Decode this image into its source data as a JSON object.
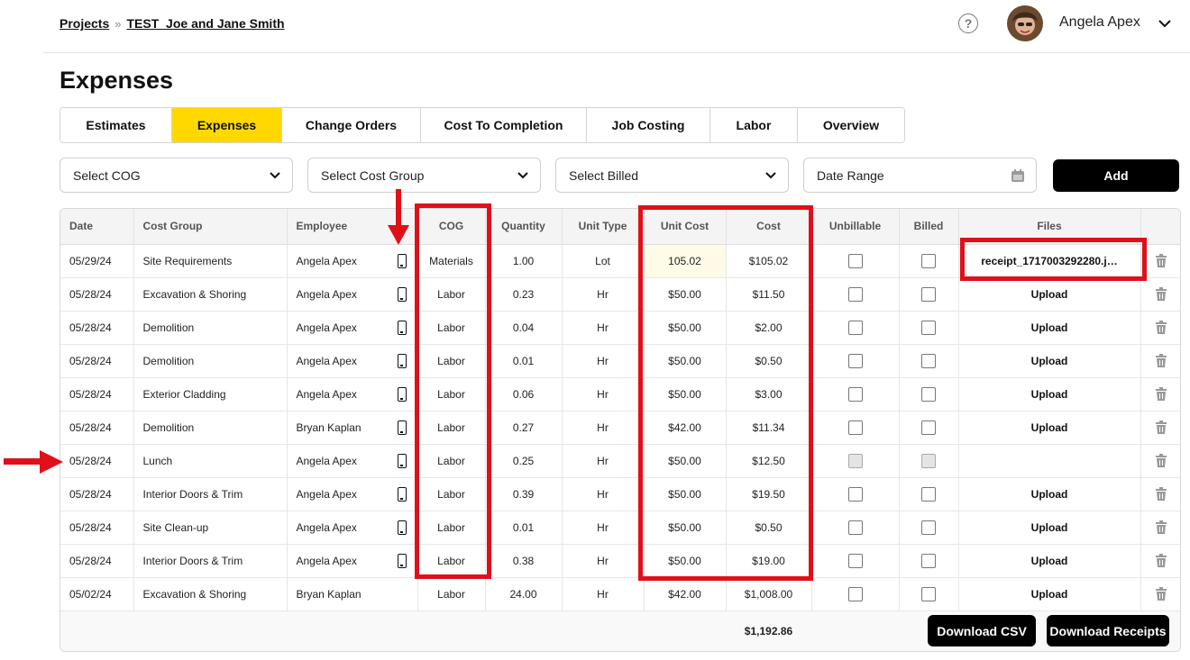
{
  "breadcrumb": {
    "projects": "Projects",
    "separator": "»",
    "project": "TEST_Joe and Jane Smith"
  },
  "header": {
    "help": "?",
    "user_name": "Angela Apex"
  },
  "page": {
    "title": "Expenses"
  },
  "tabs": [
    {
      "label": "Estimates",
      "active": false
    },
    {
      "label": "Expenses",
      "active": true
    },
    {
      "label": "Change Orders",
      "active": false
    },
    {
      "label": "Cost To Completion",
      "active": false
    },
    {
      "label": "Job Costing",
      "active": false
    },
    {
      "label": "Labor",
      "active": false
    },
    {
      "label": "Overview",
      "active": false
    }
  ],
  "filters": {
    "cog": "Select COG",
    "cost_group": "Select Cost Group",
    "billed": "Select Billed",
    "date_range": "Date Range",
    "add": "Add"
  },
  "table": {
    "columns": [
      "Date",
      "Cost Group",
      "Employee",
      "COG",
      "Quantity",
      "Unit Type",
      "Unit Cost",
      "Cost",
      "Unbillable",
      "Billed",
      "Files"
    ],
    "rows": [
      {
        "date": "05/29/24",
        "cost_group": "Site Requirements",
        "employee": "Angela Apex",
        "mobile": true,
        "cog": "Materials",
        "quantity": "1.00",
        "unit_type": "Lot",
        "unit_cost": "105.02",
        "cost": "$105.02",
        "file": "receipt_1717003292280.j…",
        "disabled": false
      },
      {
        "date": "05/28/24",
        "cost_group": "Excavation & Shoring",
        "employee": "Angela Apex",
        "mobile": true,
        "cog": "Labor",
        "quantity": "0.23",
        "unit_type": "Hr",
        "unit_cost": "$50.00",
        "cost": "$11.50",
        "file": "Upload",
        "disabled": false
      },
      {
        "date": "05/28/24",
        "cost_group": "Demolition",
        "employee": "Angela Apex",
        "mobile": true,
        "cog": "Labor",
        "quantity": "0.04",
        "unit_type": "Hr",
        "unit_cost": "$50.00",
        "cost": "$2.00",
        "file": "Upload",
        "disabled": false
      },
      {
        "date": "05/28/24",
        "cost_group": "Demolition",
        "employee": "Angela Apex",
        "mobile": true,
        "cog": "Labor",
        "quantity": "0.01",
        "unit_type": "Hr",
        "unit_cost": "$50.00",
        "cost": "$0.50",
        "file": "Upload",
        "disabled": false
      },
      {
        "date": "05/28/24",
        "cost_group": "Exterior Cladding",
        "employee": "Angela Apex",
        "mobile": true,
        "cog": "Labor",
        "quantity": "0.06",
        "unit_type": "Hr",
        "unit_cost": "$50.00",
        "cost": "$3.00",
        "file": "Upload",
        "disabled": false
      },
      {
        "date": "05/28/24",
        "cost_group": "Demolition",
        "employee": "Bryan Kaplan",
        "mobile": true,
        "cog": "Labor",
        "quantity": "0.27",
        "unit_type": "Hr",
        "unit_cost": "$42.00",
        "cost": "$11.34",
        "file": "Upload",
        "disabled": false
      },
      {
        "date": "05/28/24",
        "cost_group": "Lunch",
        "employee": "Angela Apex",
        "mobile": true,
        "cog": "Labor",
        "quantity": "0.25",
        "unit_type": "Hr",
        "unit_cost": "$50.00",
        "cost": "$12.50",
        "file": "",
        "disabled": true
      },
      {
        "date": "05/28/24",
        "cost_group": "Interior Doors & Trim",
        "employee": "Angela Apex",
        "mobile": true,
        "cog": "Labor",
        "quantity": "0.39",
        "unit_type": "Hr",
        "unit_cost": "$50.00",
        "cost": "$19.50",
        "file": "Upload",
        "disabled": false
      },
      {
        "date": "05/28/24",
        "cost_group": "Site Clean-up",
        "employee": "Angela Apex",
        "mobile": true,
        "cog": "Labor",
        "quantity": "0.01",
        "unit_type": "Hr",
        "unit_cost": "$50.00",
        "cost": "$0.50",
        "file": "Upload",
        "disabled": false
      },
      {
        "date": "05/28/24",
        "cost_group": "Interior Doors & Trim",
        "employee": "Angela Apex",
        "mobile": true,
        "cog": "Labor",
        "quantity": "0.38",
        "unit_type": "Hr",
        "unit_cost": "$50.00",
        "cost": "$19.00",
        "file": "Upload",
        "disabled": false
      },
      {
        "date": "05/02/24",
        "cost_group": "Excavation & Shoring",
        "employee": "Bryan Kaplan",
        "mobile": false,
        "cog": "Labor",
        "quantity": "24.00",
        "unit_type": "Hr",
        "unit_cost": "$42.00",
        "cost": "$1,008.00",
        "file": "Upload",
        "disabled": false
      }
    ],
    "total": "$1,192.86"
  },
  "actions": {
    "download_csv": "Download CSV",
    "download_receipts": "Download Receipts"
  },
  "colors": {
    "accent": "#ffd800",
    "annotation": "#e0101a",
    "button": "#000000"
  }
}
